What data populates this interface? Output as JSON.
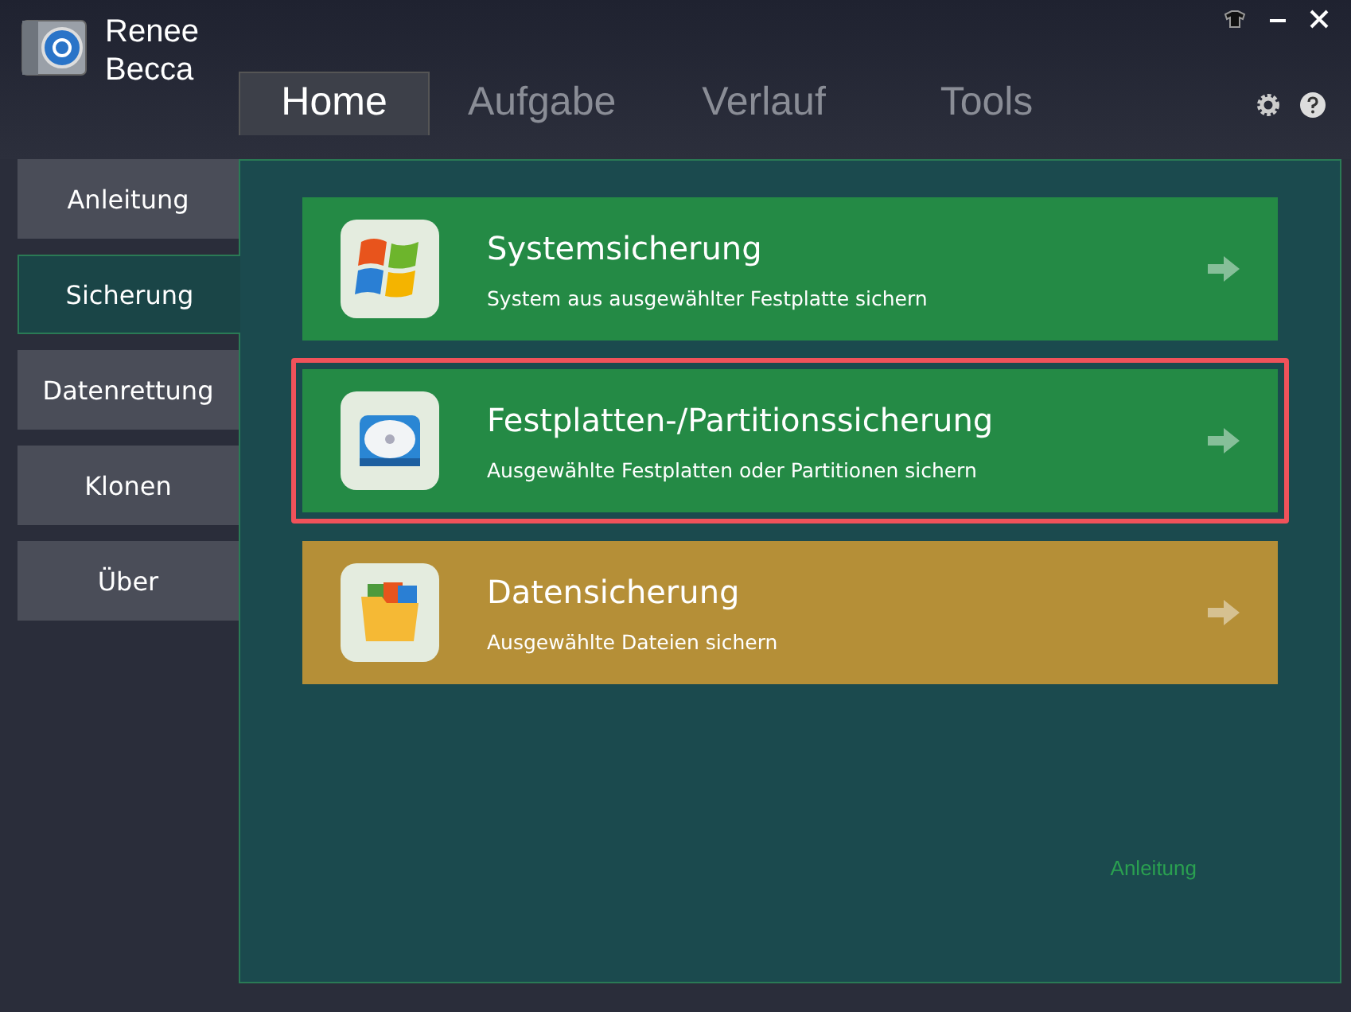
{
  "app": {
    "name_line_1": "Renee",
    "name_line_2": "Becca"
  },
  "tabs": [
    {
      "label": "Home",
      "selected": true
    },
    {
      "label": "Aufgabe",
      "selected": false
    },
    {
      "label": "Verlauf",
      "selected": false
    },
    {
      "label": "Tools",
      "selected": false
    }
  ],
  "sidebar": {
    "items": [
      {
        "label": "Anleitung",
        "selected": false
      },
      {
        "label": "Sicherung",
        "selected": true
      },
      {
        "label": "Datenrettung",
        "selected": false
      },
      {
        "label": "Klonen",
        "selected": false
      },
      {
        "label": "Über",
        "selected": false
      }
    ]
  },
  "cards": [
    {
      "kind": "windows",
      "title": "Systemsicherung",
      "description": "System aus ausgewählter Festplatte sichern",
      "color": "#248a45",
      "highlighted": false
    },
    {
      "kind": "disk",
      "title": "Festplatten-/Partitionssicherung",
      "description": "Ausgewählte Festplatten oder Partitionen sichern",
      "color": "#248a45",
      "highlighted": true
    },
    {
      "kind": "folder",
      "title": "Datensicherung",
      "description": "Ausgewählte Dateien sichern",
      "color": "#b58f37",
      "highlighted": false
    }
  ],
  "help_link": "Anleitung"
}
